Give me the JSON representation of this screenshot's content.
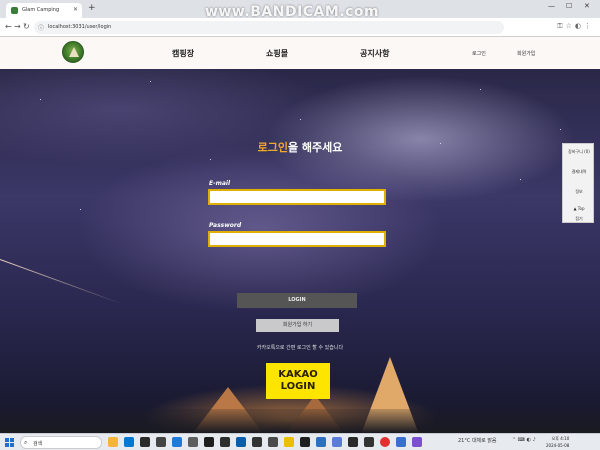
{
  "browser": {
    "tab_title": "Glam Camping",
    "new_tab_label": "+",
    "url": "localhost:3031/user/login",
    "window_controls": [
      "—",
      "☐",
      "✕"
    ]
  },
  "header": {
    "nav": [
      "캠핑장",
      "쇼핑몰",
      "공지사항"
    ],
    "auth_links": [
      "로그인",
      "회원가입"
    ]
  },
  "login": {
    "title_accent": "로그인",
    "title_rest": "을 해주세요",
    "email_label": "E-mail",
    "email_value": "",
    "password_label": "Password",
    "password_value": "",
    "login_button": "LOGIN",
    "signup_button": "회원가입 하기",
    "kakao_note": "카카오톡으로 간편 로그인 할 수 있습니다",
    "kakao_line1": "KAKAO",
    "kakao_line2": "LOGIN"
  },
  "side_menu": {
    "items": [
      "장바구니 (0)",
      "결제내역",
      "정보",
      "▲ Top",
      "접기"
    ]
  },
  "taskbar": {
    "search_placeholder": "검색",
    "weather": "21°C 대체로 맑음",
    "clock_time": "오후 4:10",
    "clock_date": "2024-05-08"
  },
  "watermark": "www.BANDICAM.com",
  "colors": {
    "title_accent": "#f0a830",
    "field_border": "#e0b000",
    "kakao": "#fee500",
    "login_button": "#555555"
  }
}
